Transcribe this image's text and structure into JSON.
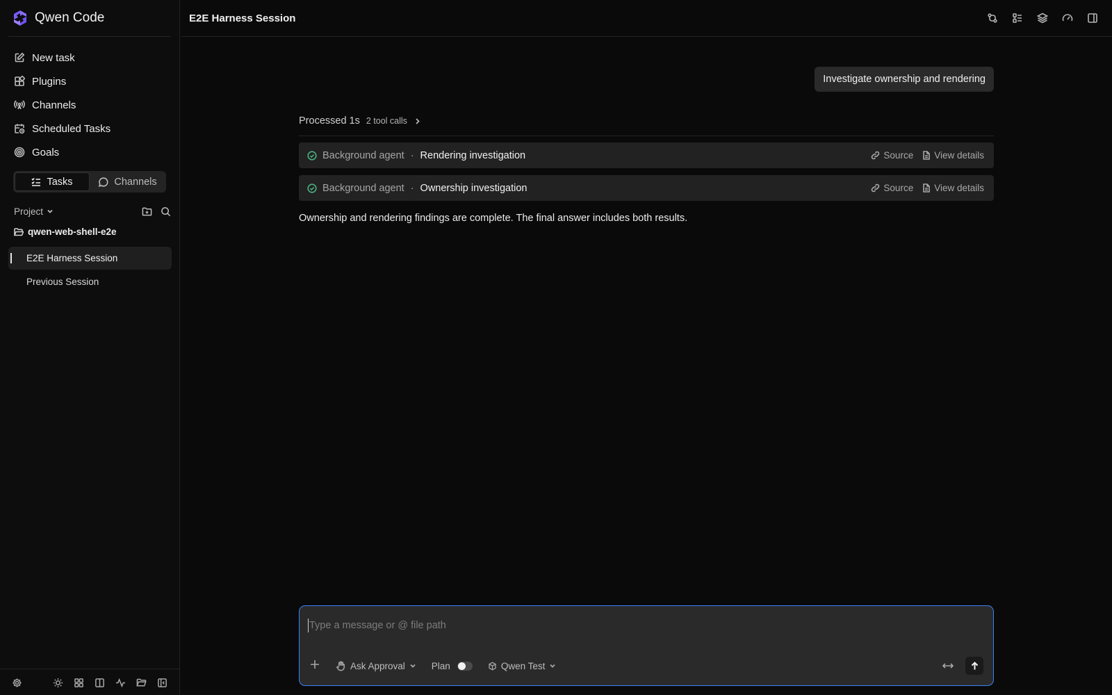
{
  "app": {
    "name": "Qwen Code",
    "accent": "#7c5cff"
  },
  "sidebar": {
    "nav": [
      {
        "label": "New task",
        "icon": "edit-icon"
      },
      {
        "label": "Plugins",
        "icon": "plugins-icon"
      },
      {
        "label": "Channels",
        "icon": "broadcast-icon"
      },
      {
        "label": "Scheduled Tasks",
        "icon": "calendar-clock-icon"
      },
      {
        "label": "Goals",
        "icon": "target-icon"
      }
    ],
    "segment": {
      "tasks": "Tasks",
      "channels": "Channels",
      "active": "Tasks"
    },
    "project_label": "Project",
    "folder": "qwen-web-shell-e2e",
    "sessions": [
      "E2E Harness Session",
      "Previous Session"
    ]
  },
  "header": {
    "title": "E2E Harness Session"
  },
  "conversation": {
    "user_message": "Investigate ownership and rendering",
    "processed": {
      "label": "Processed 1s",
      "tool_calls": "2 tool calls"
    },
    "agents": [
      {
        "kind": "Background agent",
        "name": "Rendering investigation",
        "status": "done",
        "source": "Source",
        "details": "View details"
      },
      {
        "kind": "Background agent",
        "name": "Ownership investigation",
        "status": "done",
        "source": "Source",
        "details": "View details"
      }
    ],
    "answer": "Ownership and rendering findings are complete. The final answer includes both results."
  },
  "composer": {
    "placeholder": "Type a message or @ file path",
    "value": "",
    "approval": "Ask Approval",
    "plan_label": "Plan",
    "plan_enabled": false,
    "model": "Qwen Test"
  },
  "colors": {
    "status_ok": "#4caf7d",
    "focus_border": "#3b82f6"
  }
}
